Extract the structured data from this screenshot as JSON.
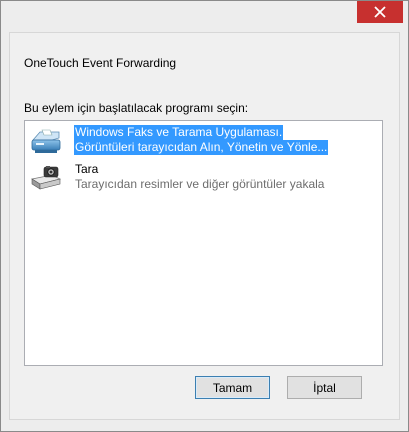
{
  "window": {
    "close_glyph": "✕",
    "heading": "OneTouch Event Forwarding",
    "prompt": "Bu eylem için başlatılacak programı seçin:"
  },
  "programs": [
    {
      "title": "Windows Faks ve Tarama Uygulaması.",
      "description": "Görüntüleri tarayıcıdan Alın, Yönetin ve Yönle...",
      "icon": "fax-scanner-icon",
      "selected": true
    },
    {
      "title": "Tara",
      "description": "Tarayıcıdan resimler ve diğer görüntüler yakala",
      "icon": "scanner-camera-icon",
      "selected": false
    }
  ],
  "buttons": {
    "ok_label": "Tamam",
    "cancel_label": "İptal"
  },
  "colors": {
    "close_button": "#c7302f",
    "selection": "#3399ff"
  }
}
